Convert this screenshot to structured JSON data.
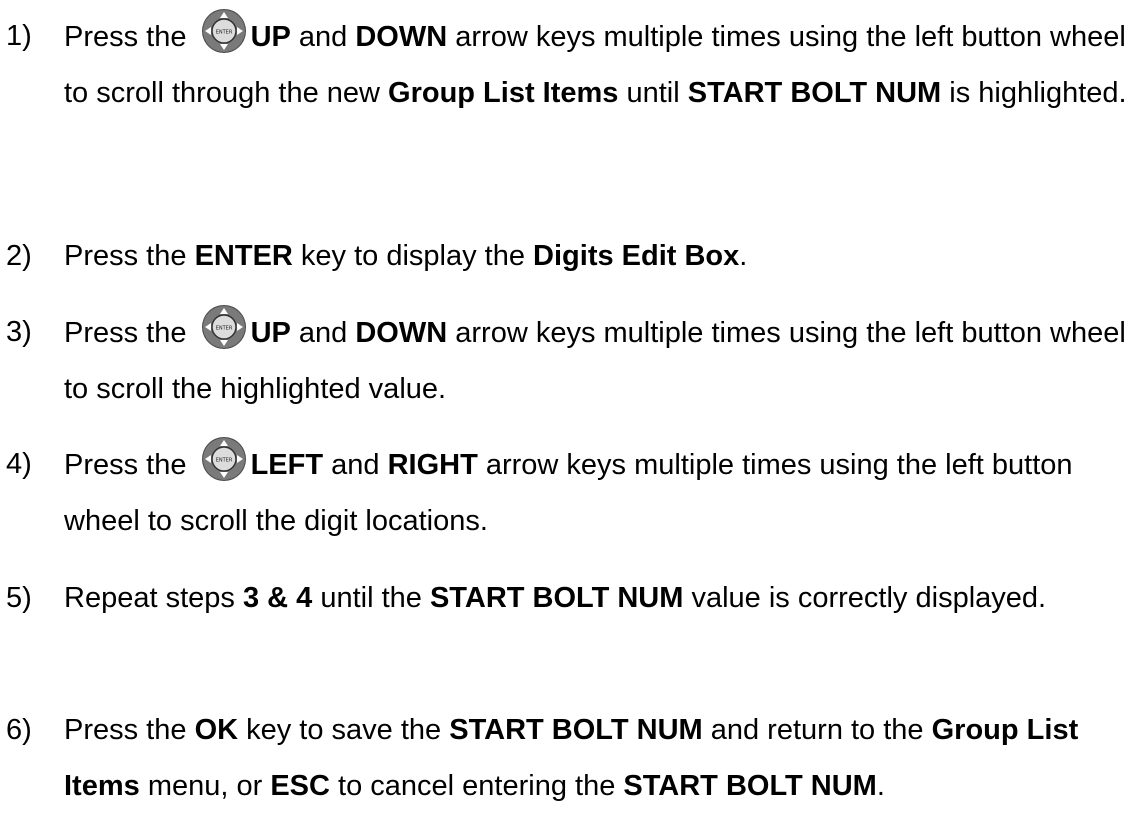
{
  "steps": [
    {
      "number": "1)",
      "segments": [
        {
          "text": "Press the ",
          "bold": false
        },
        {
          "icon": "enter-wheel-icon"
        },
        {
          "text": "UP",
          "bold": true
        },
        {
          "text": " and ",
          "bold": false
        },
        {
          "text": "DOWN",
          "bold": true
        },
        {
          "text": " arrow keys multiple times using the left button wheel to scroll through the new ",
          "bold": false
        },
        {
          "text": "Group List Items",
          "bold": true
        },
        {
          "text": " until ",
          "bold": false
        },
        {
          "text": "START BOLT NUM",
          "bold": true
        },
        {
          "text": " is highlighted.",
          "bold": false
        }
      ]
    },
    {
      "number": "2)",
      "segments": [
        {
          "text": "Press the ",
          "bold": false
        },
        {
          "text": "ENTER",
          "bold": true
        },
        {
          "text": " key to display the ",
          "bold": false
        },
        {
          "text": "Digits Edit Box",
          "bold": true
        },
        {
          "text": ".",
          "bold": false
        }
      ]
    },
    {
      "number": "3)",
      "segments": [
        {
          "text": "Press the ",
          "bold": false
        },
        {
          "icon": "enter-wheel-icon"
        },
        {
          "text": "UP",
          "bold": true
        },
        {
          "text": " and ",
          "bold": false
        },
        {
          "text": "DOWN",
          "bold": true
        },
        {
          "text": " arrow keys multiple times using the left button wheel to scroll the highlighted value.",
          "bold": false
        }
      ]
    },
    {
      "number": "4)",
      "segments": [
        {
          "text": "Press the ",
          "bold": false
        },
        {
          "icon": "enter-wheel-icon"
        },
        {
          "text": "LEFT",
          "bold": true
        },
        {
          "text": " and ",
          "bold": false
        },
        {
          "text": "RIGHT",
          "bold": true
        },
        {
          "text": " arrow keys multiple times using the left button wheel to scroll the digit locations.",
          "bold": false
        }
      ]
    },
    {
      "number": "5)",
      "segments": [
        {
          "text": "Repeat steps ",
          "bold": false
        },
        {
          "text": "3 & 4",
          "bold": true
        },
        {
          "text": " until the ",
          "bold": false
        },
        {
          "text": "START BOLT NUM",
          "bold": true
        },
        {
          "text": " value is correctly displayed.",
          "bold": false
        }
      ]
    },
    {
      "number": "6)",
      "segments": [
        {
          "text": "Press the ",
          "bold": false
        },
        {
          "text": "OK",
          "bold": true
        },
        {
          "text": " key to save the ",
          "bold": false
        },
        {
          "text": "START BOLT NUM",
          "bold": true
        },
        {
          "text": " and return to the ",
          "bold": false
        },
        {
          "text": "Group List Items",
          "bold": true
        },
        {
          "text": " menu, or ",
          "bold": false
        },
        {
          "text": "ESC",
          "bold": true
        },
        {
          "text": " to cancel entering the ",
          "bold": false
        },
        {
          "text": "START BOLT NUM",
          "bold": true
        },
        {
          "text": ".",
          "bold": false
        }
      ]
    }
  ],
  "icon_label": "ENTER"
}
